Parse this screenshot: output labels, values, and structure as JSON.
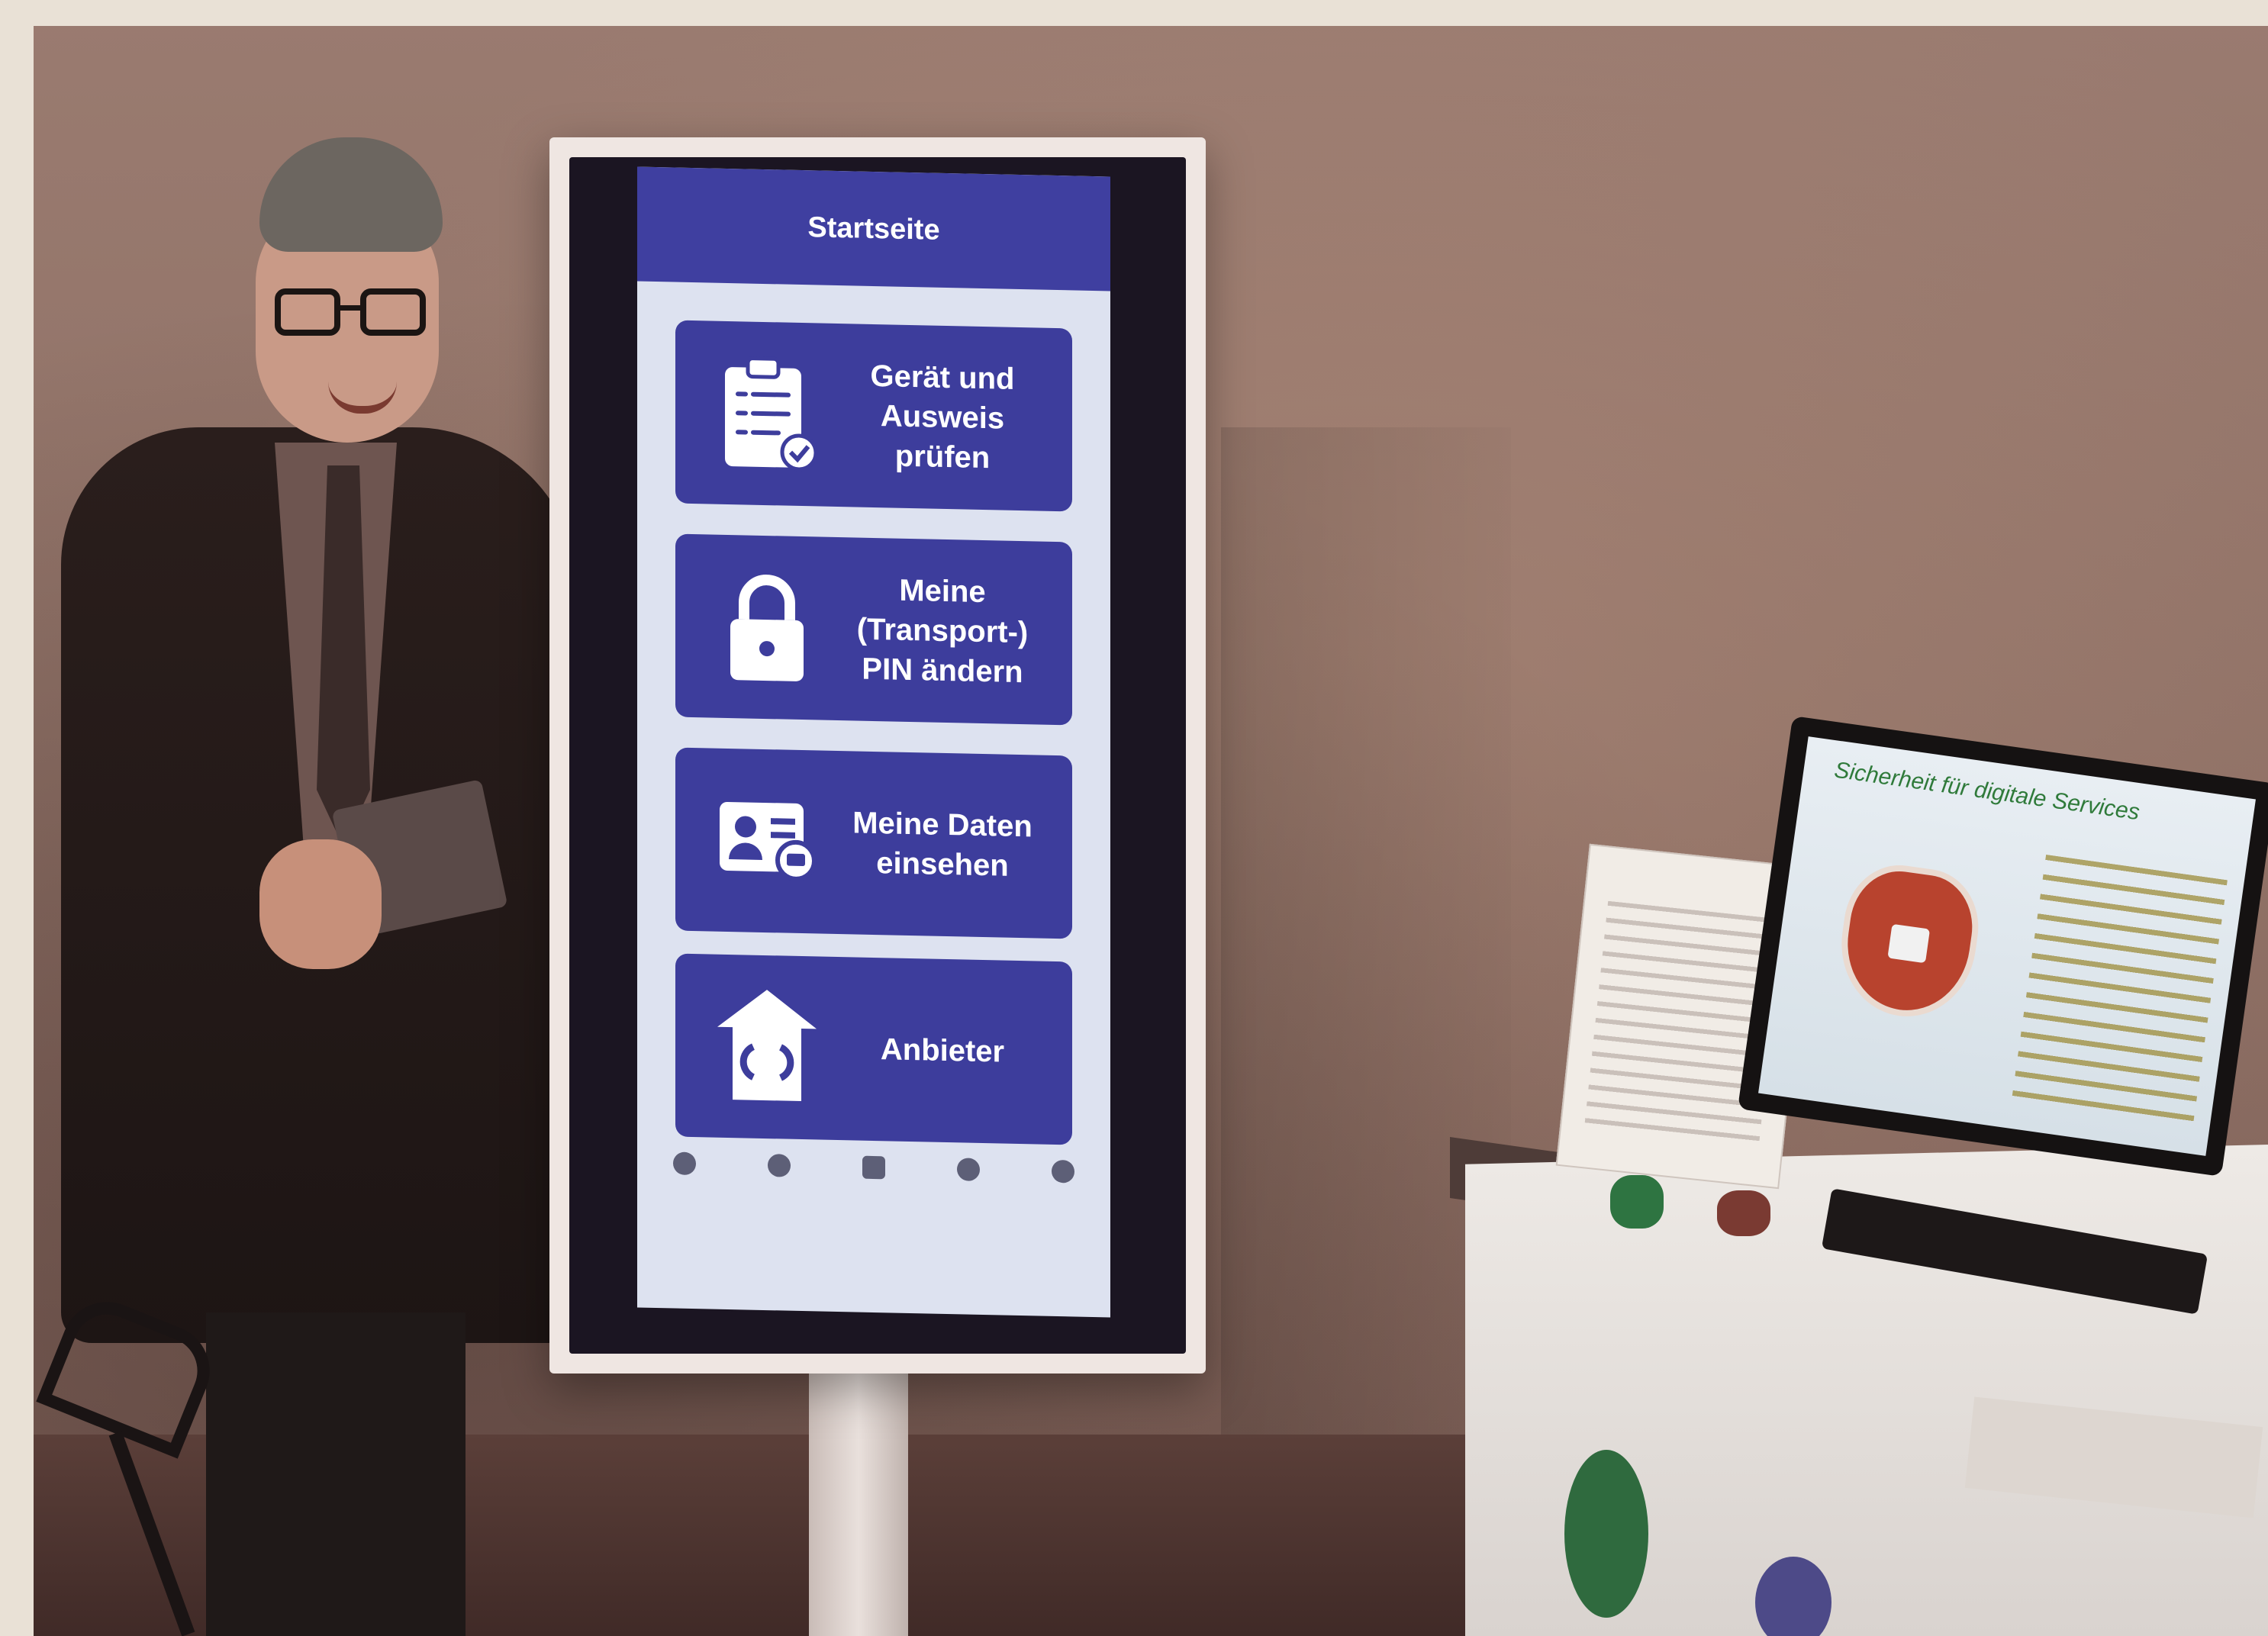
{
  "kiosk_app": {
    "header_title": "Startseite",
    "tiles": [
      {
        "label": "Gerät und\nAusweis\nprüfen",
        "icon": "clipboard-check-icon"
      },
      {
        "label": "Meine\n(Transport-)\nPIN ändern",
        "icon": "padlock-icon"
      },
      {
        "label": "Meine Daten\neinsehen",
        "icon": "id-card-icon"
      },
      {
        "label": "Anbieter",
        "icon": "provider-house-icon"
      }
    ],
    "bottom_nav": [
      {
        "label": "",
        "icon": "home-icon"
      },
      {
        "label": "",
        "icon": "wallet-icon"
      },
      {
        "label": "",
        "icon": "phone-icon"
      },
      {
        "label": "",
        "icon": "info-icon"
      },
      {
        "label": "",
        "icon": "more-icon"
      }
    ],
    "colors": {
      "primary": "#3f3fa0",
      "tile": "#3d3d9c",
      "screen_bg": "#dde2f0"
    }
  },
  "monitor": {
    "title": "Sicherheit für digitale Services"
  }
}
